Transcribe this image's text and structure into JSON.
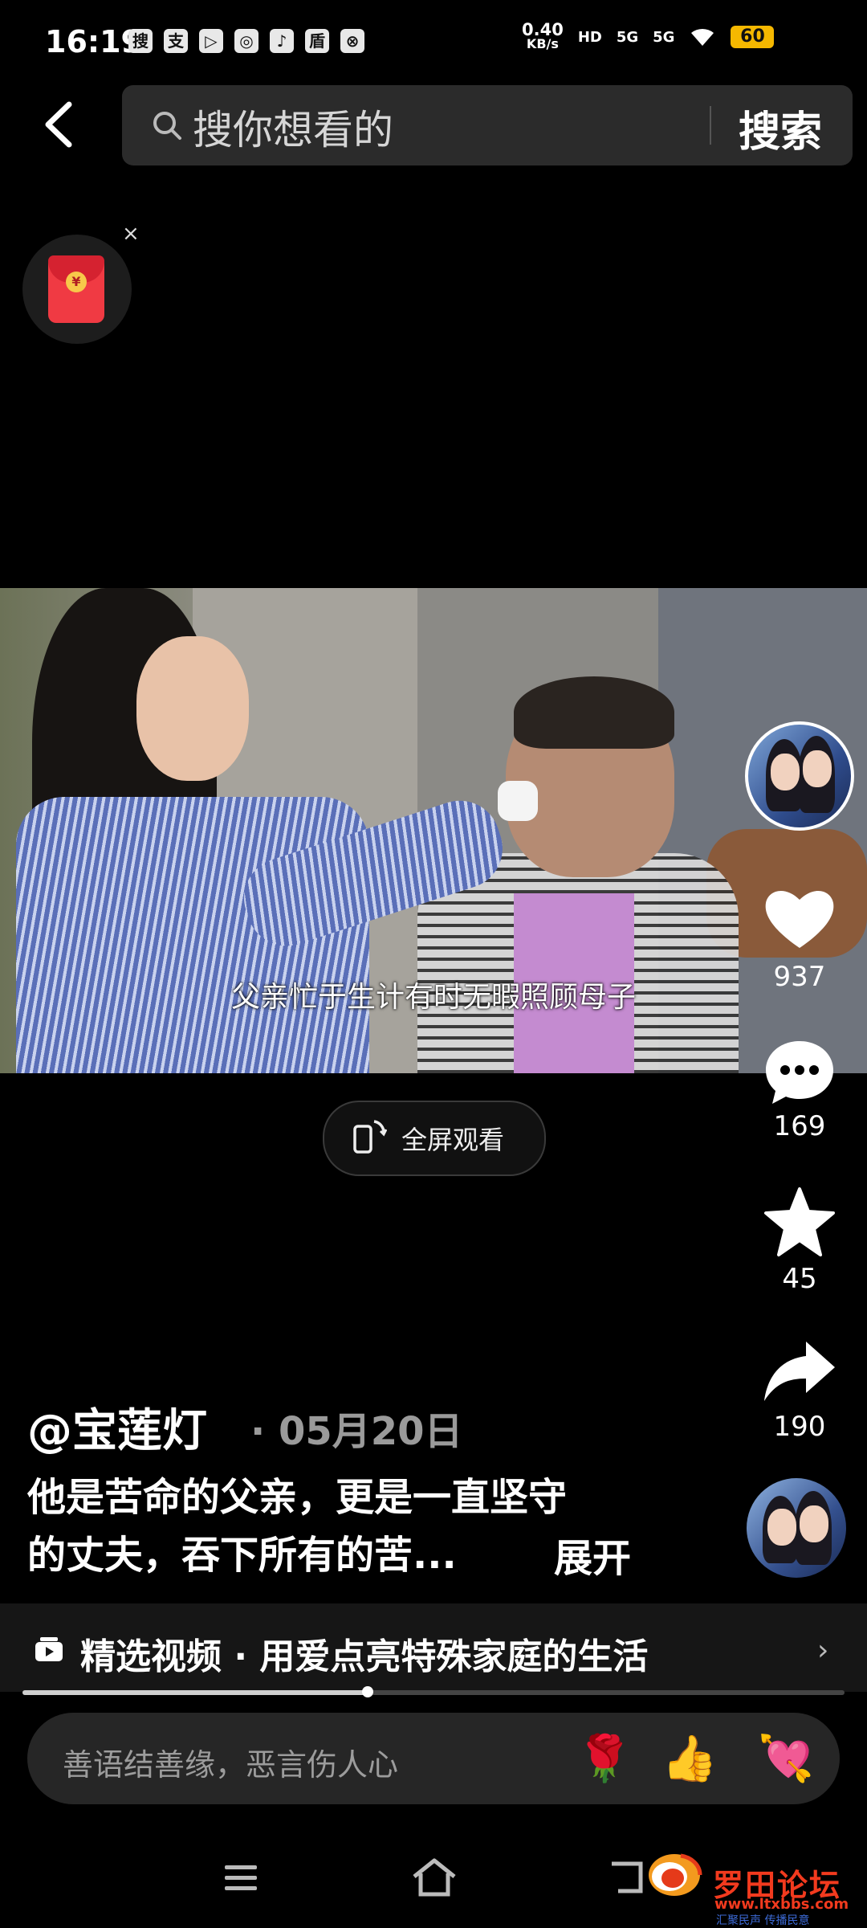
{
  "status_bar": {
    "time": "16:19",
    "app_icons": [
      "搜",
      "支",
      "▷",
      "◎",
      "♪",
      "盾",
      "⊗"
    ],
    "net_speed_value": "0.40",
    "net_speed_unit": "KB/s",
    "hd": "HD",
    "sim1": "5G",
    "sim2": "5G",
    "battery": "60",
    "battery_color": "#f5b800"
  },
  "search": {
    "placeholder": "搜你想看的",
    "button": "搜索"
  },
  "video": {
    "subtitle": "父亲忙于生计有时无暇照顾母子",
    "fullscreen_label": "全屏观看"
  },
  "actions": {
    "likes": "937",
    "comments": "169",
    "favorites": "45",
    "shares": "190"
  },
  "post": {
    "author": "@宝莲灯",
    "date": "· 05月20日",
    "caption_line1": "他是苦命的父亲，更是一直坚守",
    "caption_line2": "的丈夫，吞下所有的苦...",
    "expand": "展开"
  },
  "collection": {
    "label": "精选视频 · 用爱点亮特殊家庭的生活",
    "progress": 0.42
  },
  "comment_input": {
    "placeholder": "善语结善缘，恶言伤人心",
    "emojis": [
      "🌹",
      "👍",
      "💘"
    ]
  },
  "watermark": {
    "title": "罗田论坛",
    "url": "www.ltxbbs.com",
    "slogan": "汇聚民声 传播民意"
  }
}
